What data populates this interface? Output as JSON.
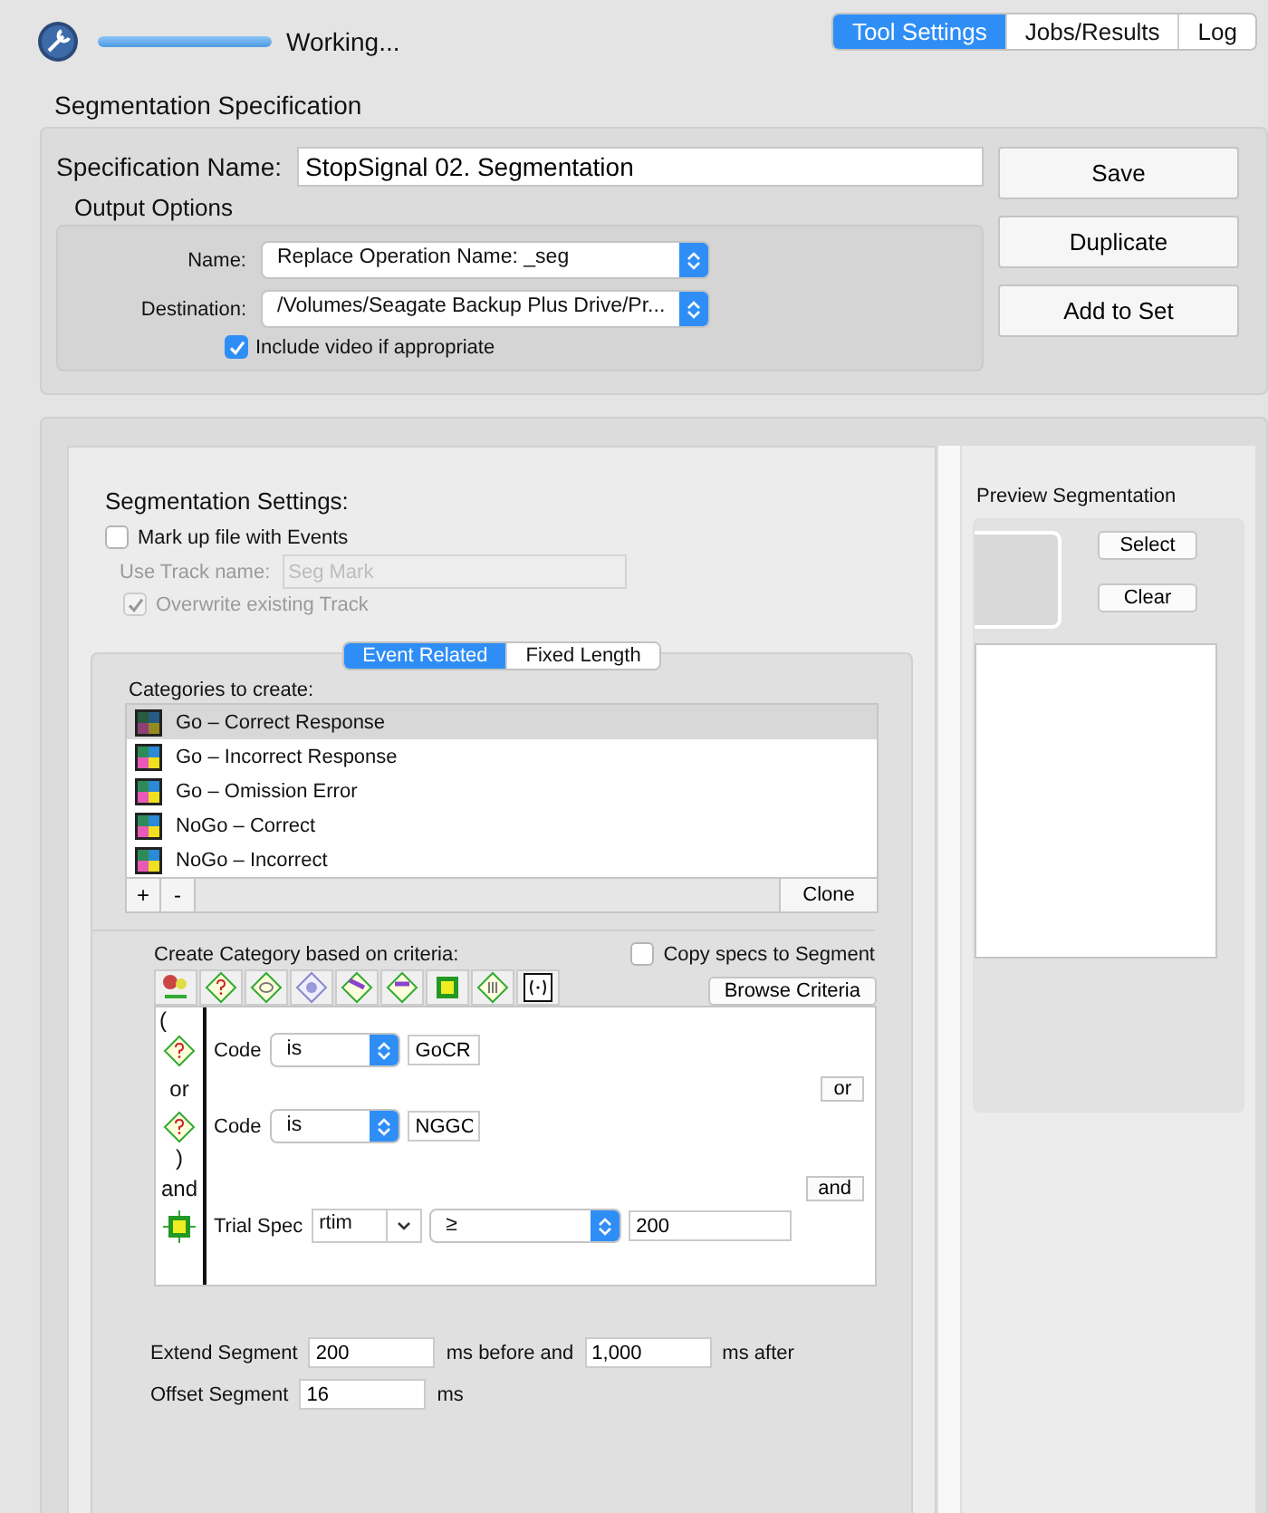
{
  "toolbar": {
    "status": "Working...",
    "progress": {
      "level": 1
    }
  },
  "tabs": [
    {
      "label": "Tool Settings",
      "selected": true
    },
    {
      "label": "Jobs/Results",
      "selected": false
    },
    {
      "label": "Log",
      "selected": false
    }
  ],
  "spec": {
    "title": "Segmentation Specification",
    "name_label": "Specification Name:",
    "name_value": "StopSignal 02. Segmentation",
    "output_title": "Output Options",
    "popups": [
      {
        "label": "Name:",
        "value": "Replace Operation Name: _seg"
      },
      {
        "label": "Destination:",
        "value": "/Volumes/Seagate Backup Plus Drive/Pr..."
      }
    ],
    "include_video": {
      "label": "Include video if appropriate",
      "checked": true
    },
    "buttons": [
      "Save",
      "Duplicate",
      "Add to Set"
    ]
  },
  "settings": {
    "title": "Segmentation Settings:",
    "markup": {
      "label": "Mark up file with Events",
      "checked": false
    },
    "track_name": {
      "label": "Use Track name:",
      "placeholder": "Seg Mark",
      "disabled": true
    },
    "overwrite": {
      "label": "Overwrite existing Track",
      "checked": true,
      "disabled": true
    },
    "mode_tabs": [
      {
        "label": "Event Related",
        "selected": true
      },
      {
        "label": "Fixed Length",
        "selected": false
      }
    ],
    "categories": {
      "label": "Categories to create:",
      "items": [
        {
          "name": "Go – Correct Response",
          "selected": true
        },
        {
          "name": "Go – Incorrect Response",
          "selected": false
        },
        {
          "name": "Go – Omission Error",
          "selected": false
        },
        {
          "name": "NoGo – Correct",
          "selected": false
        },
        {
          "name": "NoGo – Incorrect",
          "selected": false
        }
      ],
      "add": "+",
      "remove": "-",
      "clone": "Clone"
    },
    "criteria": {
      "label": "Create Category based on criteria:",
      "copy_specs": {
        "label": "Copy specs to Segment",
        "checked": false
      },
      "browse": "Browse Criteria",
      "rows": [
        {
          "kind": "open",
          "text": "("
        },
        {
          "kind": "code",
          "label": "Code",
          "operator": "is",
          "value": "GoCR"
        },
        {
          "kind": "join",
          "text": "or",
          "button": "or"
        },
        {
          "kind": "code",
          "label": "Code",
          "operator": "is",
          "value": "NGGC"
        },
        {
          "kind": "close",
          "text": ")"
        },
        {
          "kind": "join",
          "text": "and",
          "button": "and"
        },
        {
          "kind": "trial",
          "label": "Trial Spec",
          "variable": "rtim",
          "operator": "≥",
          "value": "200"
        }
      ]
    },
    "extend": {
      "label": "Extend Segment",
      "before": "200",
      "before_unit": "ms before and",
      "after": "1,000",
      "after_unit": "ms after"
    },
    "offset": {
      "label": "Offset Segment",
      "value": "16",
      "unit": "ms"
    }
  },
  "preview": {
    "title": "Preview Segmentation",
    "select": "Select",
    "clear": "Clear"
  }
}
